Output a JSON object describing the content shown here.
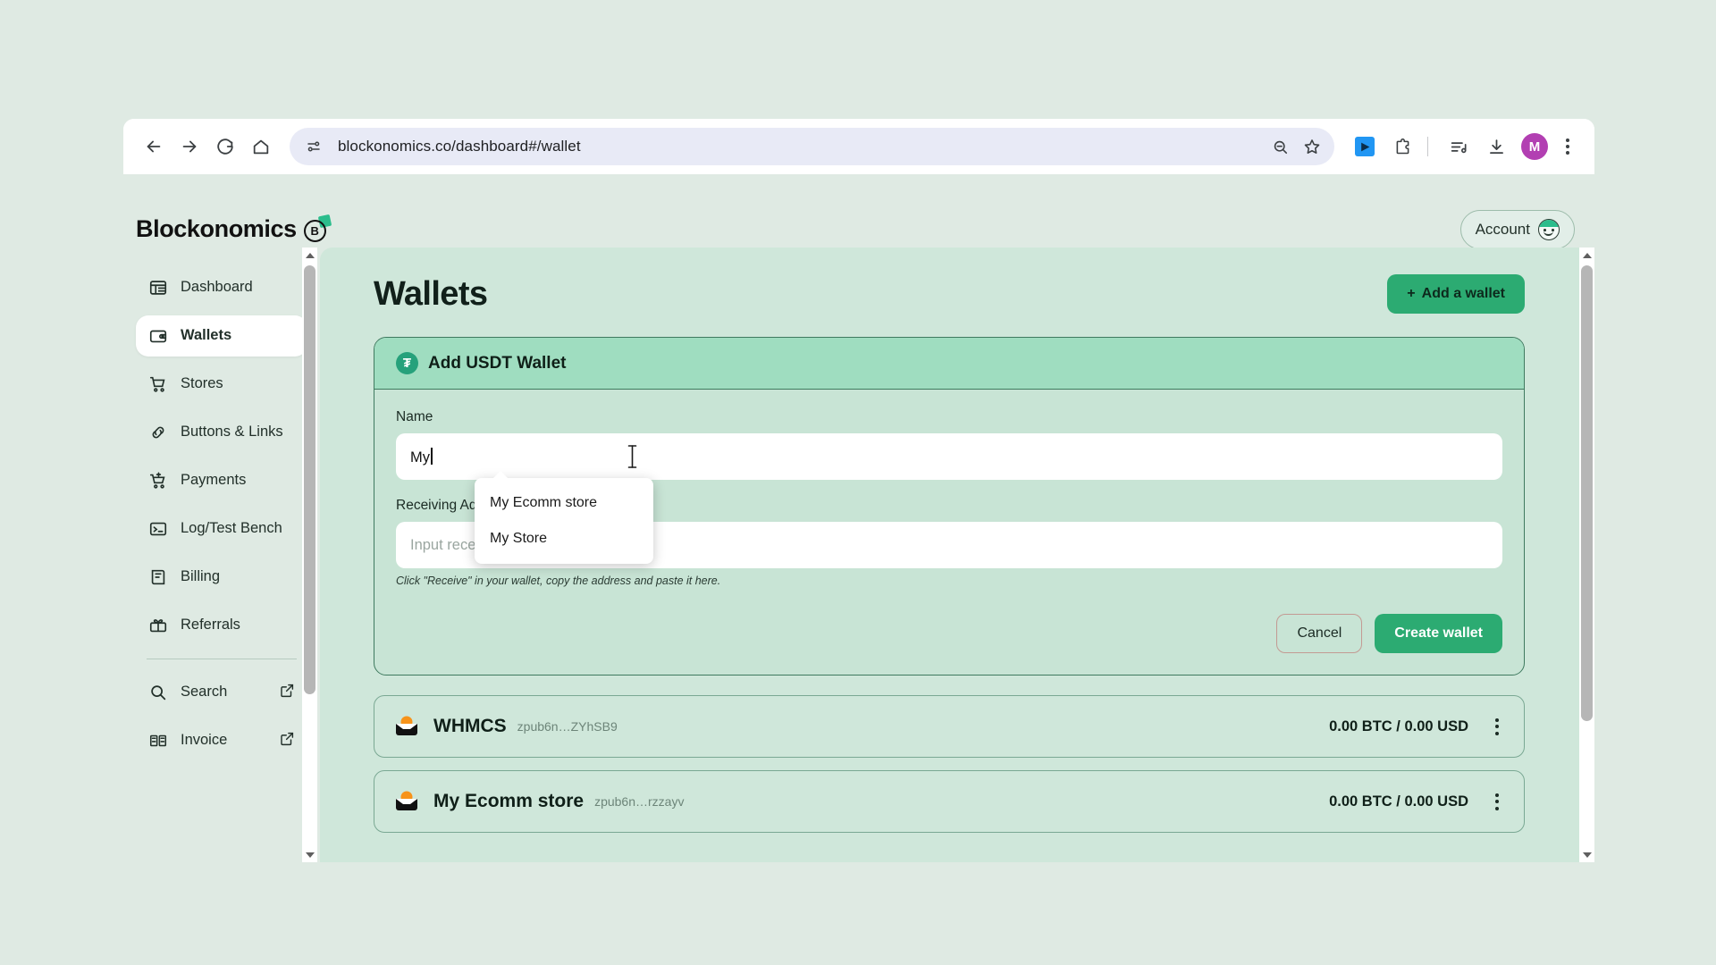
{
  "browser": {
    "back_icon": "back-arrow-icon",
    "forward_icon": "forward-arrow-icon",
    "reload_icon": "reload-icon",
    "home_icon": "home-icon",
    "site_settings_icon": "site-settings-icon",
    "url": "blockonomics.co/dashboard#/wallet",
    "zoom_out_icon": "zoom-out-icon",
    "bookmark_icon": "star-icon",
    "extension_blue_icon": "media-player-extension-icon",
    "extensions_icon": "extensions-puzzle-icon",
    "reading_list_icon": "reading-list-icon",
    "downloads_icon": "download-icon",
    "profile_initial": "M",
    "menu_icon": "three-dot-menu-icon"
  },
  "header": {
    "logo_text": "Blockonomics",
    "logo_mark_letter": "B",
    "account_label": "Account"
  },
  "sidebar": {
    "items": [
      {
        "label": "Dashboard",
        "icon": "dashboard-icon",
        "active": false,
        "external": false
      },
      {
        "label": "Wallets",
        "icon": "wallet-icon",
        "active": true,
        "external": false
      },
      {
        "label": "Stores",
        "icon": "cart-icon",
        "active": false,
        "external": false
      },
      {
        "label": "Buttons & Links",
        "icon": "link-icon",
        "active": false,
        "external": false
      },
      {
        "label": "Payments",
        "icon": "cart-plus-icon",
        "active": false,
        "external": false
      },
      {
        "label": "Log/Test Bench",
        "icon": "terminal-icon",
        "active": false,
        "external": false
      },
      {
        "label": "Billing",
        "icon": "billing-icon",
        "active": false,
        "external": false
      },
      {
        "label": "Referrals",
        "icon": "gift-icon",
        "active": false,
        "external": false
      }
    ],
    "secondary_items": [
      {
        "label": "Search",
        "icon": "search-icon",
        "external": true
      },
      {
        "label": "Invoice",
        "icon": "invoice-icon",
        "external": true
      }
    ]
  },
  "main": {
    "page_title": "Wallets",
    "add_wallet_button": "+ Add a wallet",
    "add_wallet_plus": "+",
    "add_wallet_text": "Add a wallet",
    "card": {
      "title": "Add USDT Wallet",
      "tether_symbol": "₮",
      "name_label": "Name",
      "name_value": "My",
      "address_label": "Receiving Address",
      "address_placeholder": "Input receiving address",
      "address_hint": "Click \"Receive\" in your wallet, copy the address and paste it here.",
      "cancel_label": "Cancel",
      "create_label": "Create wallet"
    },
    "autofill_options": [
      "My Ecomm store",
      "My Store"
    ],
    "wallets": [
      {
        "name": "WHMCS",
        "xpub": "zpub6n…ZYhSB9",
        "balance": "0.00 BTC / 0.00 USD"
      },
      {
        "name": "My Ecomm store",
        "xpub": "zpub6n…rzzayv",
        "balance": "0.00 BTC / 0.00 USD"
      }
    ]
  },
  "colors": {
    "page_background": "#dfeae3",
    "main_background": "#cfe7da",
    "card_header": "#9fddc0",
    "card_body": "#c8e4d5",
    "accent_green": "#2cab72",
    "tether_green": "#26a17b",
    "cancel_border": "#c39a93"
  }
}
